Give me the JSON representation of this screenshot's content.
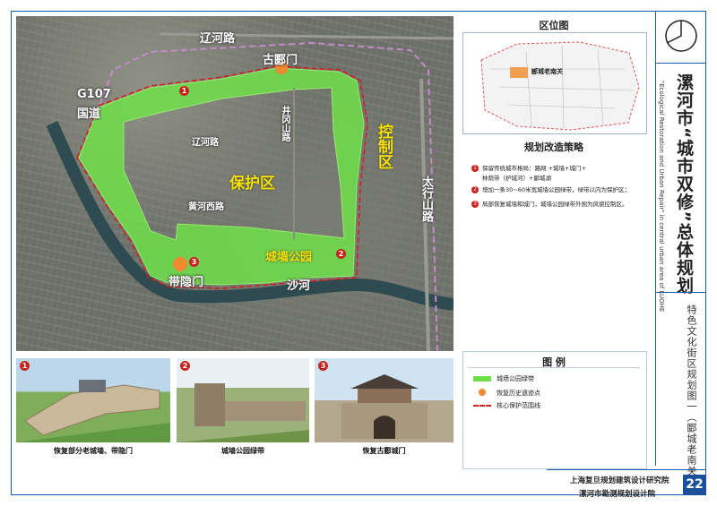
{
  "map": {
    "labels": {
      "liaohe_road_top": "辽河路",
      "gulumen": "古郾门",
      "g107": "G107",
      "g107_sub": "国道",
      "jingwenshan_road": "井冈山路",
      "liaohe_road_inner": "辽河路",
      "protect_zone": "保护区",
      "control_zone": "控制区",
      "taihangshan_road": "太行山路",
      "huanghe_west_road": "黄河西路",
      "city_wall_park": "城墙公园",
      "daiyin_gate": "带隐门",
      "sha_river": "沙河"
    },
    "markers": [
      "1",
      "2",
      "3"
    ]
  },
  "location_map": {
    "title": "区位图",
    "tag": "郾城老南关"
  },
  "strategy": {
    "title": "规划改造策略",
    "items": [
      {
        "num": "1",
        "text": "保留传统城市格局：路网 +城墙+城门+"
      },
      {
        "num": "",
        "text": "林荫带（护城河）+郾城湖"
      },
      {
        "num": "2",
        "text": "增加一条30~60米宽城墙公园绿带，绿带以内为保护区；"
      },
      {
        "num": "3",
        "text": "局部恢复城墙和城门，城墙公园绿带外围为风貌控制区。"
      }
    ]
  },
  "legend": {
    "title": "图 例",
    "items": [
      {
        "label": "城墙公园绿带",
        "color": "#6fe04a"
      },
      {
        "label": "恢复历史遗迹点",
        "color": "#f08a30"
      },
      {
        "label": "核心保护范围线",
        "color": "#d21f1f"
      }
    ]
  },
  "photos": [
    {
      "num": "1",
      "caption": "恢复部分老城墙、带隐门"
    },
    {
      "num": "2",
      "caption": "城墙公园绿带"
    },
    {
      "num": "3",
      "caption": "恢复古郾城门"
    }
  ],
  "title": {
    "main": "漯河市“城市双修”总体规划",
    "english": "\"Ecological Restoration and Urban Repair\" in central urban area of LUOHE",
    "subtitle": "特色文化街区规划图一（郾城老南关）"
  },
  "footer": {
    "org1": "上海复旦规划建筑设计研究院",
    "org2": "漯河市勘测规划设计院",
    "page": "22"
  },
  "colors": {
    "frame": "#1a5aa8",
    "green_belt": "#6fe04a",
    "relic_point": "#f08a30",
    "core_line": "#d21f1f",
    "zone_label": "#f6e200"
  }
}
